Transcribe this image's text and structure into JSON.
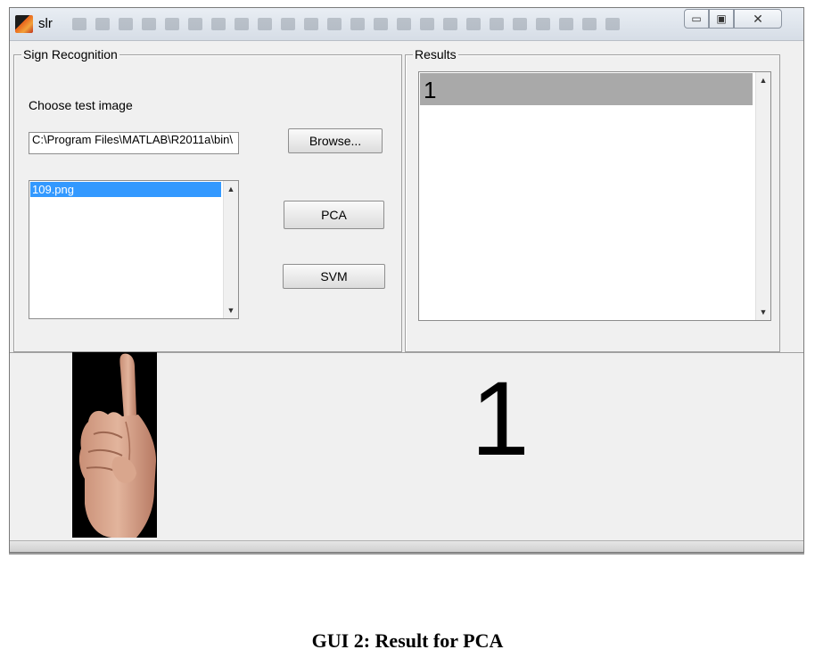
{
  "window": {
    "title": "slr",
    "controls": {
      "minimize": "▭",
      "maximize": "▣",
      "close": "✕"
    }
  },
  "left_panel": {
    "title": "Sign Recognition",
    "choose_label": "Choose test image",
    "path_value": "C:\\Program Files\\MATLAB\\R2011a\\bin\\",
    "browse_label": "Browse...",
    "files": [
      "109.png"
    ],
    "pca_label": "PCA",
    "svm_label": "SVM"
  },
  "right_panel": {
    "title": "Results",
    "items": [
      "1"
    ]
  },
  "result_display": "1",
  "caption": "GUI 2: Result for PCA",
  "colors": {
    "selection_blue": "#3399ff",
    "result_highlight": "#a9a9a9",
    "window_bg": "#f0f0f0"
  },
  "icons": [
    "matlab-icon",
    "hand-sign-image",
    "scroll-up-icon",
    "scroll-down-icon"
  ]
}
